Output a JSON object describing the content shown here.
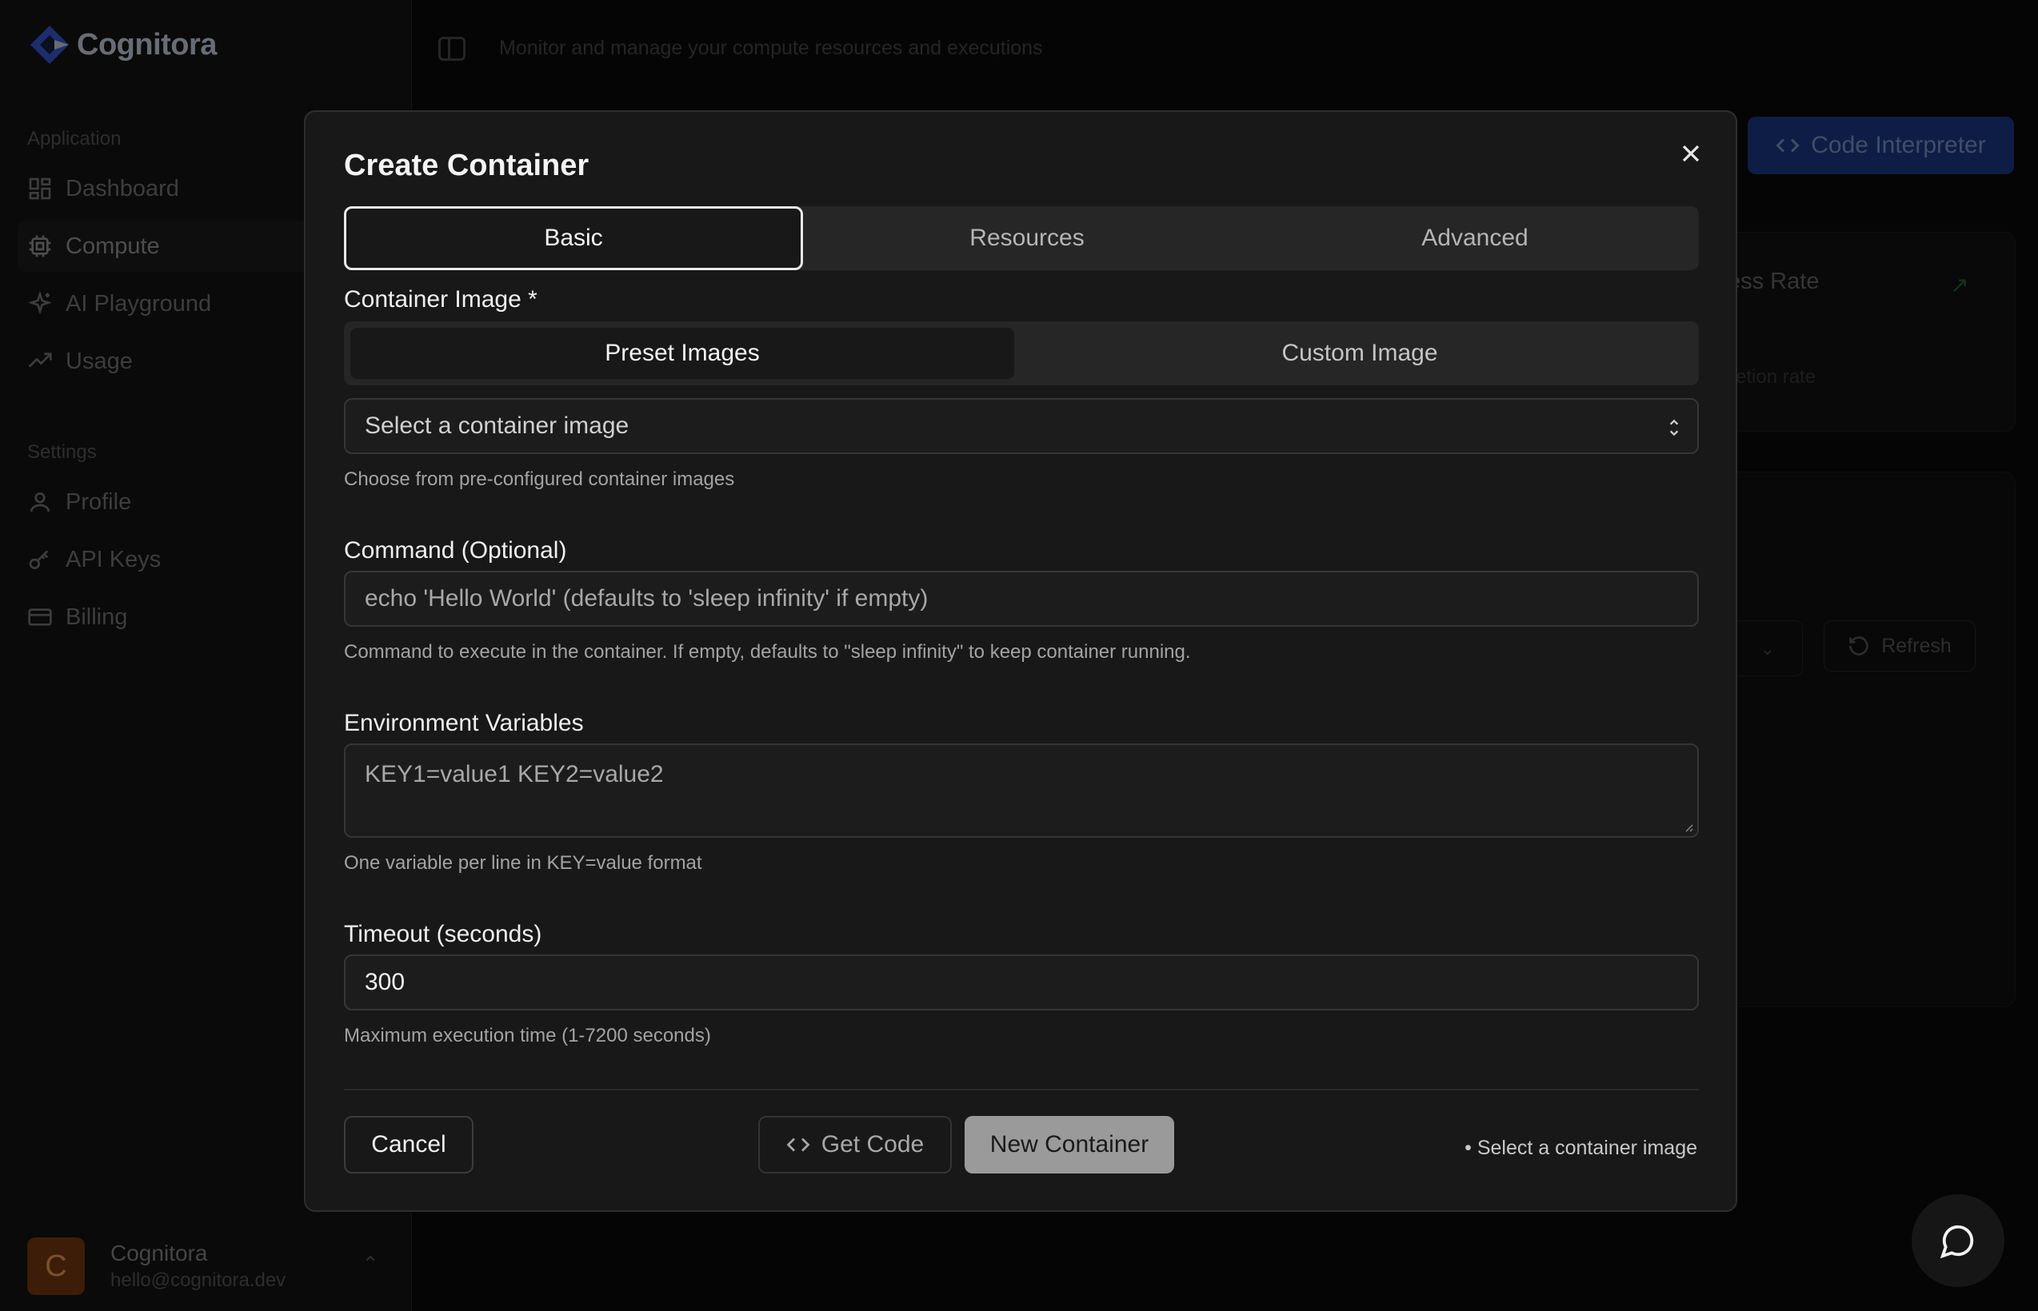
{
  "app": {
    "brand": "Cognitora",
    "topbar_description": "Monitor and manage your compute resources and executions"
  },
  "sidebar": {
    "sections": [
      {
        "title": "Application",
        "items": [
          {
            "label": "Dashboard",
            "icon": "dashboard-icon"
          },
          {
            "label": "Compute",
            "icon": "cpu-icon",
            "active": true
          },
          {
            "label": "AI Playground",
            "icon": "sparkles-icon"
          },
          {
            "label": "Usage",
            "icon": "trending-icon"
          }
        ]
      },
      {
        "title": "Settings",
        "items": [
          {
            "label": "Profile",
            "icon": "user-icon"
          },
          {
            "label": "API Keys",
            "icon": "key-icon"
          },
          {
            "label": "Billing",
            "icon": "credit-card-icon"
          }
        ]
      }
    ],
    "user": {
      "initial": "C",
      "name": "Cognitora",
      "email": "hello@cognitora.dev"
    }
  },
  "background": {
    "code_interpreter_label": "Code Interpreter",
    "card_title": "ess Rate",
    "card_subtitle": "etion rate",
    "refresh_label": "Refresh"
  },
  "modal": {
    "title": "Create Container",
    "tabs": [
      {
        "label": "Basic",
        "active": true
      },
      {
        "label": "Resources",
        "active": false
      },
      {
        "label": "Advanced",
        "active": false
      }
    ],
    "container_image": {
      "label": "Container Image *",
      "source_tabs": [
        {
          "label": "Preset Images",
          "active": true
        },
        {
          "label": "Custom Image",
          "active": false
        }
      ],
      "select_placeholder": "Select a container image",
      "help": "Choose from pre-configured container images"
    },
    "command": {
      "label": "Command (Optional)",
      "placeholder": "echo 'Hello World' (defaults to 'sleep infinity' if empty)",
      "help": "Command to execute in the container. If empty, defaults to \"sleep infinity\" to keep container running."
    },
    "env": {
      "label": "Environment Variables",
      "placeholder": "KEY1=value1 KEY2=value2",
      "help": "One variable per line in KEY=value format"
    },
    "timeout": {
      "label": "Timeout (seconds)",
      "value": "300",
      "help": "Maximum execution time (1-7200 seconds)"
    },
    "buttons": {
      "cancel": "Cancel",
      "get_code": "Get Code",
      "new_container": "New Container"
    },
    "validation_hint": "• Select a container image"
  },
  "colors": {
    "accent_blue": "#1d3a8a",
    "avatar_bg": "#7a3a0e",
    "disabled_button": "#9a9a9a"
  }
}
